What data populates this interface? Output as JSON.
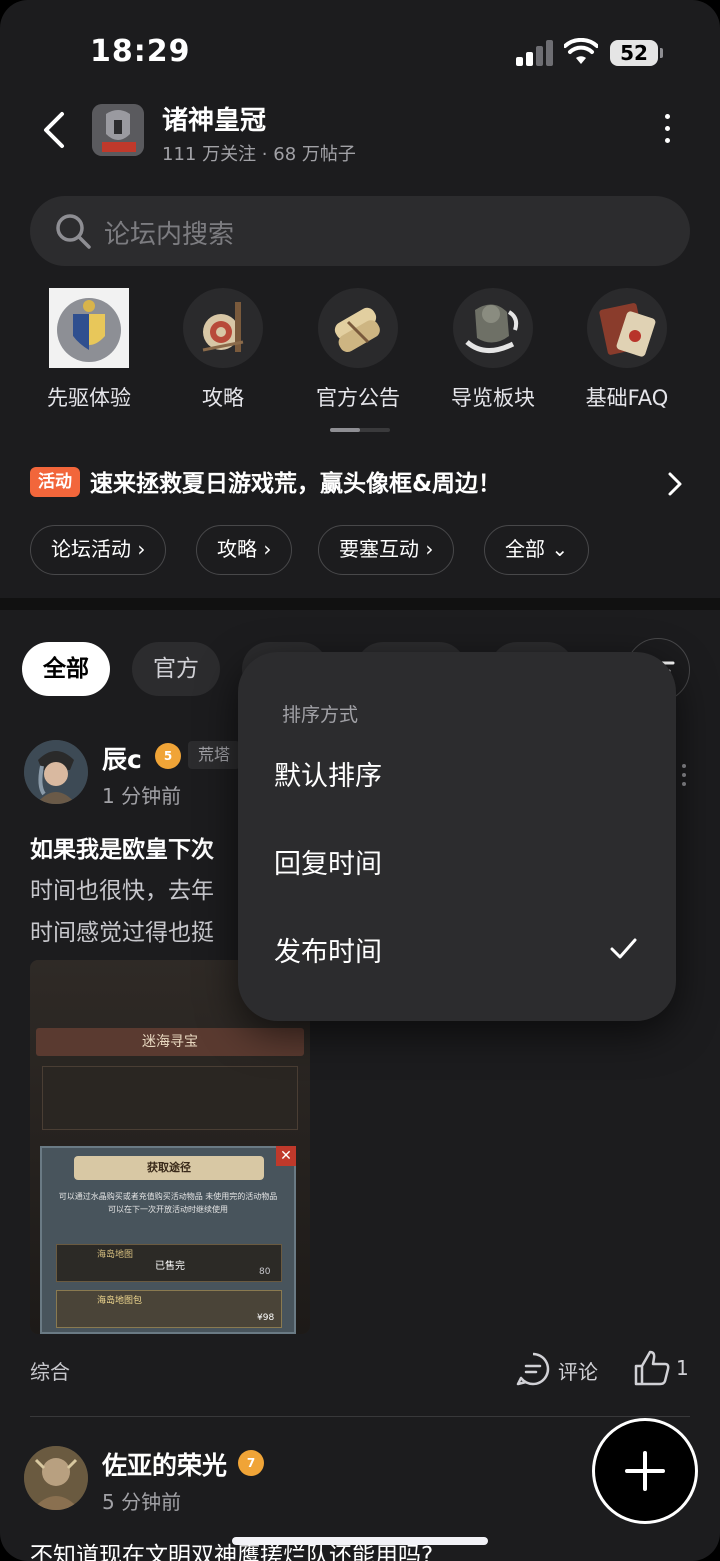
{
  "status_bar": {
    "time": "18:29",
    "battery": "52"
  },
  "header": {
    "title": "诸神皇冠",
    "meta": "111 万关注 · 68 万帖子"
  },
  "search": {
    "placeholder": "论坛内搜索"
  },
  "categories": [
    {
      "label": "先驱体验",
      "icon": "shield-icon"
    },
    {
      "label": "攻略",
      "icon": "target-icon"
    },
    {
      "label": "官方公告",
      "icon": "scroll-icon"
    },
    {
      "label": "导览板块",
      "icon": "armor-icon"
    },
    {
      "label": "基础FAQ",
      "icon": "book-icon"
    }
  ],
  "activity": {
    "badge": "活动",
    "text": "速来拯救夏日游戏荒，赢头像框&周边！"
  },
  "chips": [
    "论坛活动",
    "攻略",
    "要塞互动",
    "全部"
  ],
  "tabs": [
    "全部",
    "官方"
  ],
  "sort_menu": {
    "header": "排序方式",
    "options": [
      "默认排序",
      "回复时间",
      "发布时间"
    ],
    "selected": "发布时间"
  },
  "posts": [
    {
      "author": "辰c",
      "level": "5",
      "tag": "荒塔",
      "time": "1 分钟前",
      "title": "如果我是欧皇下次",
      "body_lines": [
        "时间也很快，去年",
        "时间感觉过得也挺"
      ],
      "image_texts": {
        "banner": "迷海寻宝",
        "dialog_title": "获取途径",
        "dialog_desc": "可以通过水晶购买或者充值购买活动物品 未使用完的活动物品可以在下一次开放活动时继续使用",
        "row1_name": "海岛地图",
        "row1_status": "已售完",
        "row1_price": "80",
        "row2_name": "海岛地图包",
        "row2_price": "¥98"
      },
      "category": "综合",
      "comment_label": "评论",
      "likes": "1"
    },
    {
      "author": "佐亚的荣光",
      "level": "7",
      "time": "5 分钟前",
      "title": "不知道现在文明双神鹰搓烂队还能用吗?"
    }
  ],
  "colors": {
    "accent": "#f2663b",
    "level_badge": "#f0a437",
    "background": "#1c1c1e"
  }
}
